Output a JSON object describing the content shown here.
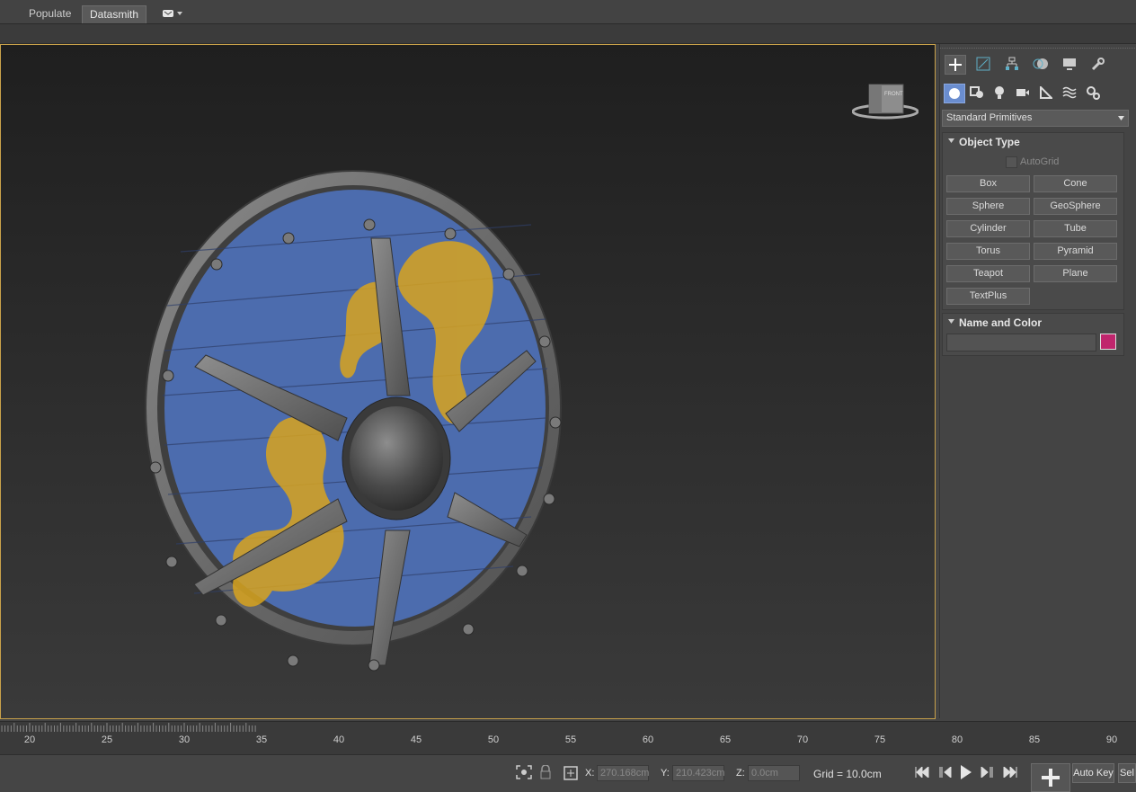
{
  "tabs": {
    "populate": "Populate",
    "datasmith": "Datasmith"
  },
  "command_panel": {
    "category_dropdown": "Standard Primitives",
    "object_type": {
      "title": "Object Type",
      "autogrid_label": "AutoGrid",
      "buttons": [
        "Box",
        "Cone",
        "Sphere",
        "GeoSphere",
        "Cylinder",
        "Tube",
        "Torus",
        "Pyramid",
        "Teapot",
        "Plane",
        "TextPlus"
      ]
    },
    "name_and_color": {
      "title": "Name and Color",
      "name_value": "",
      "color": "#c0256d"
    }
  },
  "viewcube": {
    "label": "FRONT"
  },
  "timeline": {
    "ticks": [
      "20",
      "25",
      "30",
      "35",
      "40",
      "45",
      "50",
      "55",
      "60",
      "65",
      "70",
      "75",
      "80",
      "85",
      "90"
    ]
  },
  "status": {
    "x_label": "X:",
    "x_value": "270.168cm",
    "y_label": "Y:",
    "y_value": "210.423cm",
    "z_label": "Z:",
    "z_value": "0.0cm",
    "grid": "Grid = 10.0cm",
    "autokey": "Auto Key",
    "sel": "Sel"
  },
  "colors": {
    "accent_border": "#c8a14a",
    "shield_blue": "#4c6cae",
    "dragon_yellow": "#d8a41f"
  }
}
